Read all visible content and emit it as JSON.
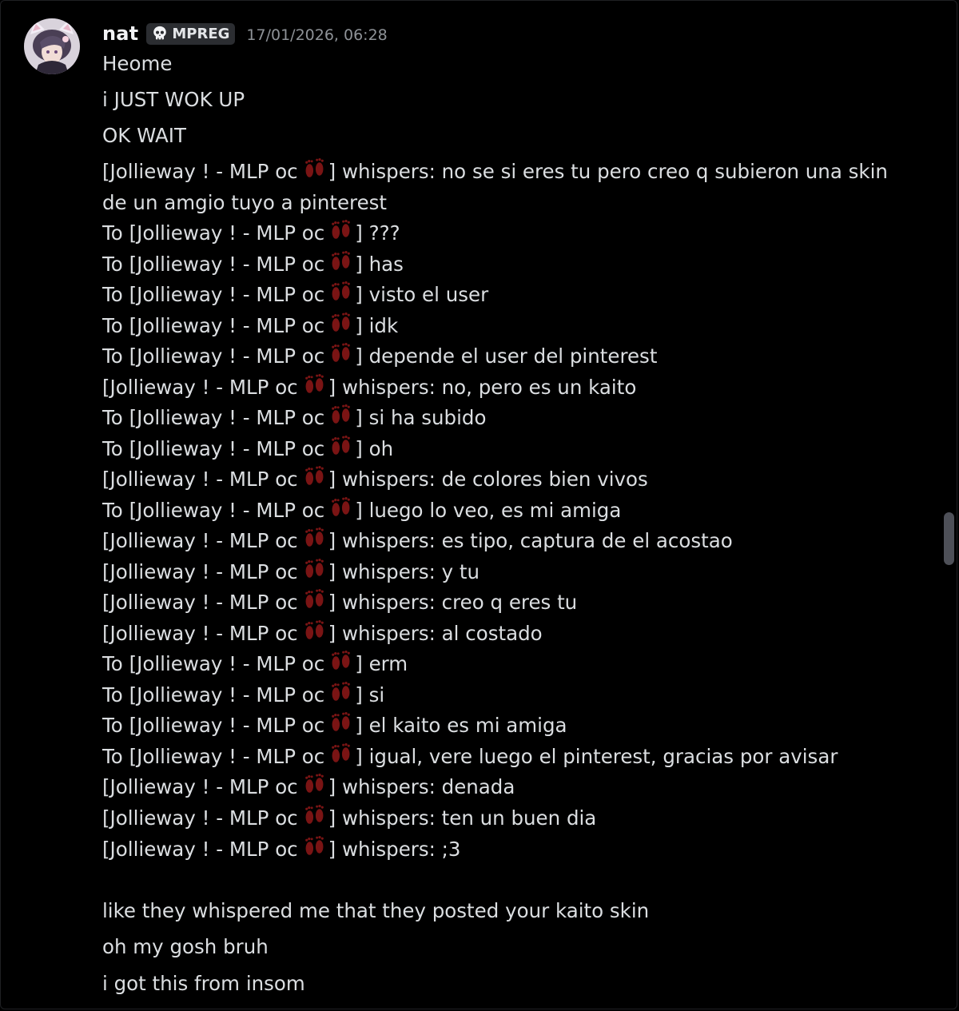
{
  "message": {
    "username": "nat",
    "role_tag": "MPREG",
    "role_icon": "skull-icon",
    "timestamp": "17/01/2026, 06:28"
  },
  "lines": [
    "Heome",
    "i JUST WOK UP",
    "OK WAIT",
    [
      "[Jollieway ! - MLP oc ",
      "] whispers: no se si eres tu pero creo q subieron una skin de un amgio tuyo a pinterest"
    ],
    [
      "To [Jollieway ! - MLP oc ",
      "] ???"
    ],
    [
      "To [Jollieway ! - MLP oc ",
      "] has"
    ],
    [
      "To [Jollieway ! - MLP oc ",
      "] visto el user"
    ],
    [
      "To [Jollieway ! - MLP oc ",
      "] idk"
    ],
    [
      "To [Jollieway ! - MLP oc ",
      "] depende el user del pinterest"
    ],
    [
      "[Jollieway ! - MLP oc ",
      "] whispers: no, pero es un kaito"
    ],
    [
      "To [Jollieway ! - MLP oc ",
      "] si ha subido"
    ],
    [
      "To [Jollieway ! - MLP oc ",
      "] oh"
    ],
    [
      "[Jollieway ! - MLP oc ",
      "] whispers: de colores bien vivos"
    ],
    [
      "To [Jollieway ! - MLP oc ",
      "] luego lo veo, es mi amiga"
    ],
    [
      "[Jollieway ! - MLP oc ",
      "] whispers: es tipo, captura de el acostao"
    ],
    [
      "[Jollieway ! - MLP oc ",
      "] whispers: y tu"
    ],
    [
      "[Jollieway ! - MLP oc ",
      "] whispers: creo q eres tu"
    ],
    [
      "[Jollieway ! - MLP oc ",
      "] whispers: al costado"
    ],
    [
      "To [Jollieway ! - MLP oc ",
      "] erm"
    ],
    [
      "To [Jollieway ! - MLP oc ",
      "] si"
    ],
    [
      "To [Jollieway ! - MLP oc ",
      "] el kaito es mi amiga"
    ],
    [
      "To [Jollieway ! - MLP oc ",
      "] igual, vere luego el pinterest, gracias por avisar"
    ],
    [
      "[Jollieway ! - MLP oc ",
      "] whispers: denada"
    ],
    [
      "[Jollieway ! - MLP oc ",
      "] whispers: ten un buen dia"
    ],
    [
      "[Jollieway ! - MLP oc ",
      "] whispers: ;3"
    ],
    "like they whispered me that they posted your kaito skin",
    "oh my gosh bruh",
    "i got this from insom"
  ],
  "emoji": "footprints-icon",
  "colors": {
    "background": "#000000",
    "username": "#f2f3f5",
    "text": "#dbdee1",
    "timestamp": "#8e9297",
    "tag_bg": "#2b2d31",
    "footprint": "#7a1414"
  }
}
